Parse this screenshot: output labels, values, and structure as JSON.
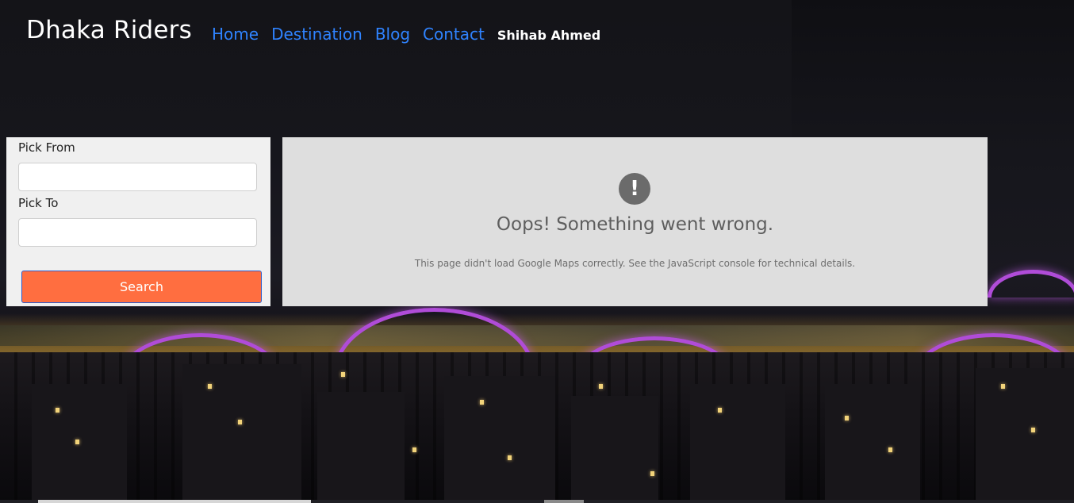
{
  "navbar": {
    "brand": "Dhaka Riders",
    "links": [
      "Home",
      "Destination",
      "Blog",
      "Contact"
    ],
    "user_name": "Shihab Ahmed"
  },
  "form": {
    "pick_from_label": "Pick From",
    "pick_from_value": "",
    "pick_to_label": "Pick To",
    "pick_to_value": "",
    "search_label": "Search",
    "button_color": "#ff6e40"
  },
  "map": {
    "error_icon": "!",
    "error_title": "Oops! Something went wrong.",
    "error_description": "This page didn't load Google Maps correctly. See the JavaScript console for technical details."
  },
  "colors": {
    "link": "#2f83ff",
    "bridge_arch": "#b04cd8"
  }
}
